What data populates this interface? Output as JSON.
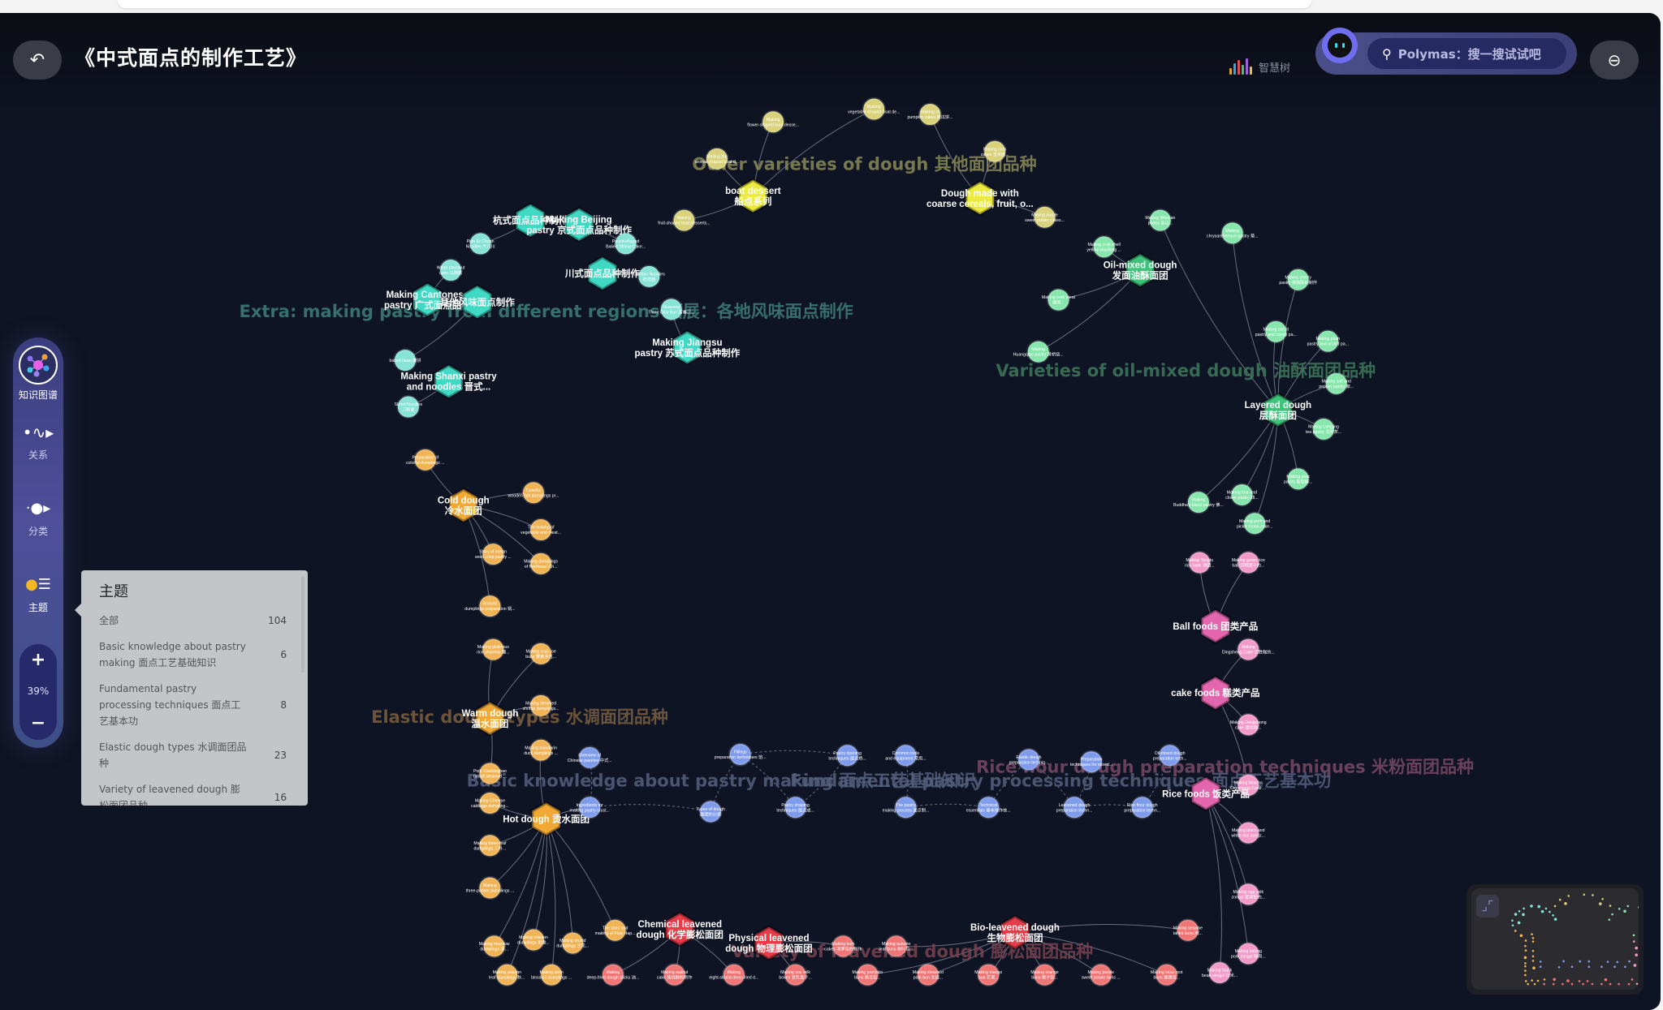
{
  "header": {
    "title": "《中式面点的制作工艺》",
    "logo_text": "智慧树",
    "search_placeholder": "Polymas：搜一搜试试吧",
    "back_icon": "back-arrow-icon",
    "right_icon": "exit-icon"
  },
  "sidebar": {
    "items": [
      {
        "label": "知识图谱",
        "icon": "knowledge-graph-icon",
        "active": true
      },
      {
        "label": "关系",
        "icon": "relation-icon"
      },
      {
        "label": "分类",
        "icon": "category-icon"
      },
      {
        "label": "主题",
        "icon": "topic-icon"
      }
    ],
    "zoom": {
      "plus": "+",
      "value": "39%",
      "minus": "−"
    }
  },
  "topic_panel": {
    "title": "主题",
    "items": [
      {
        "label": "全部",
        "count": "104"
      },
      {
        "label": "Basic knowledge about pastry making 面点工艺基础知识",
        "count": "6"
      },
      {
        "label": "Fundamental pastry processing techniques 面点工艺基本功",
        "count": "8"
      },
      {
        "label": "Elastic dough types 水调面团品种",
        "count": "23"
      },
      {
        "label": "Variety of leavened dough 膨松面团品种",
        "count": "16"
      }
    ]
  },
  "colors": {
    "yellow": {
      "leaf": "#d9d27a",
      "hub": "#ecea3c",
      "label": "#8a8a55"
    },
    "teal": {
      "leaf": "#86e3d6",
      "hub": "#3fd9c4",
      "label": "#3f7f7a"
    },
    "green": {
      "leaf": "#86e6ac",
      "hub": "#3cc47a",
      "label": "#3f7a5c"
    },
    "orange": {
      "leaf": "#f0b457",
      "hub": "#f2a934",
      "label": "#7a6040"
    },
    "blue": {
      "leaf": "#7f9cec",
      "hub": "#6f8ce8",
      "label": "#55607f"
    },
    "pink": {
      "leaf": "#f29bc8",
      "hub": "#e466ae",
      "label": "#7a4a66"
    },
    "red": {
      "leaf": "#f07575",
      "hub": "#e83c48",
      "label": "#7a4450"
    }
  },
  "clusters": [
    {
      "id": "c1",
      "group": "yellow",
      "label": "Other varieties of dough 其他面团品种"
    },
    {
      "id": "c2",
      "group": "teal",
      "label": "Extra: making pastry from different regions 拓展：各地风味面点制作"
    },
    {
      "id": "c3",
      "group": "green",
      "label": "Varieties of oil-mixed dough 油酥面团品种"
    },
    {
      "id": "c4",
      "group": "orange",
      "label": "Elastic dough types 水调面团品种"
    },
    {
      "id": "c5",
      "group": "blue",
      "label": "Basic knowledge about pastry making 面点工艺基础知识"
    },
    {
      "id": "c6",
      "group": "blue",
      "label": "Fundamental pastry processing techniques 面点工艺基本功"
    },
    {
      "id": "c7",
      "group": "pink",
      "label": "Rice flour dough preparation techniques 米粉面团品种"
    },
    {
      "id": "c8",
      "group": "red",
      "label": "Variety of leavened dough 膨松面团品种"
    }
  ],
  "nodes": [
    {
      "id": "y1",
      "group": "yellow",
      "hub": true,
      "lines": [
        "boat dessert",
        "船点系列"
      ]
    },
    {
      "id": "y2",
      "group": "yellow",
      "parent": "y1",
      "lines": [
        "Making",
        "flower-shaped boat desse..."
      ]
    },
    {
      "id": "y3",
      "group": "yellow",
      "parent": "y1",
      "lines": [
        "Making the",
        "animal-shaped boat d..."
      ]
    },
    {
      "id": "y4",
      "group": "yellow",
      "parent": "y1",
      "lines": [
        "Making",
        "fruit-shaped boat desserts..."
      ]
    },
    {
      "id": "y5",
      "group": "yellow",
      "parent": "y1",
      "lines": [
        "Making",
        "vegetable-shaped boat de..."
      ]
    },
    {
      "id": "y6",
      "group": "yellow",
      "hub": true,
      "lines": [
        "Dough made with",
        "coarse cereals, fruit, o..."
      ]
    },
    {
      "id": "y7",
      "group": "yellow",
      "parent": "y6",
      "lines": [
        "Making of",
        "pumpkin cakes 南瓜饼..."
      ]
    },
    {
      "id": "y8",
      "group": "yellow",
      "parent": "y6",
      "lines": [
        "Making corn",
        "cakes 玉米面..."
      ]
    },
    {
      "id": "y9",
      "group": "yellow",
      "parent": "y6",
      "lines": [
        "Making purple",
        "sweet potato cakes..."
      ]
    },
    {
      "id": "t1",
      "group": "teal",
      "hub": true,
      "lines": [
        "杭式面点品种制作"
      ]
    },
    {
      "id": "t2",
      "group": "teal",
      "hub": true,
      "lines": [
        "Making Beijing",
        "pastry 京式面点品种制作"
      ]
    },
    {
      "id": "t3",
      "group": "teal",
      "parent": "t1",
      "lines": [
        "Pian Er Chuan",
        "Noodles 片儿川"
      ]
    },
    {
      "id": "t4",
      "group": "teal",
      "parent": "t2",
      "lines": [
        "Pouch-shaped",
        "Baked Wheat Cake..."
      ]
    },
    {
      "id": "t5",
      "group": "teal",
      "hub": true,
      "lines": [
        "川式面点品种制作"
      ]
    },
    {
      "id": "t6",
      "group": "teal",
      "parent": "t5",
      "lines": [
        "Dandan Noodles",
        "担担面"
      ]
    },
    {
      "id": "t7",
      "group": "teal",
      "parent": "t8",
      "lines": [
        "Water chestnut",
        "cake 马蹄糕"
      ]
    },
    {
      "id": "t8",
      "group": "teal",
      "hub": true,
      "lines": [
        "Making Cantonese",
        "pastry 广式面点品种"
      ]
    },
    {
      "id": "t9",
      "group": "teal",
      "hub": true,
      "lines": [
        "其他风味面点制作"
      ]
    },
    {
      "id": "t10",
      "group": "teal",
      "parent": "t11",
      "lines": [
        "Huasong",
        "Three Dice Bun 富春三..."
      ]
    },
    {
      "id": "t11",
      "group": "teal",
      "hub": true,
      "lines": [
        "Making Jiangsu",
        "pastry 苏式面点品种制作"
      ]
    },
    {
      "id": "t12",
      "group": "teal",
      "parent": "t9",
      "lines": [
        "baked naan 馕饼"
      ]
    },
    {
      "id": "t13",
      "group": "teal",
      "hub": true,
      "lines": [
        "Making Shanxi pastry",
        "and noodles 晋式..."
      ]
    },
    {
      "id": "t14",
      "group": "teal",
      "parent": "t13",
      "lines": [
        "Sliced Noodles",
        "刀削面"
      ]
    },
    {
      "id": "g1",
      "group": "green",
      "hub": true,
      "lines": [
        "Oil-mixed dough",
        "发面油酥面团"
      ]
    },
    {
      "id": "g2",
      "group": "green",
      "parent": "g1",
      "lines": [
        "Making crab shell",
        "yellow shaobing ..."
      ]
    },
    {
      "id": "g3",
      "group": "green",
      "parent": "g1",
      "lines": [
        "Making pork meat",
        "猪肉..."
      ]
    },
    {
      "id": "g4",
      "group": "green",
      "parent": "g1",
      "lines": [
        "Making",
        "Huangqiao pastry 黄桥烧..."
      ]
    },
    {
      "id": "g5",
      "group": "green",
      "hub": true,
      "lines": [
        "Layered dough",
        "层酥面团"
      ]
    },
    {
      "id": "g6",
      "group": "green",
      "parent": "g5",
      "lines": [
        "Making Wushan",
        "pastry 巫山..."
      ]
    },
    {
      "id": "g7",
      "group": "green",
      "parent": "g5",
      "lines": [
        "Making",
        "chrysanthemum pastry 菊..."
      ]
    },
    {
      "id": "g8",
      "group": "green",
      "parent": "g5",
      "lines": [
        "Making cherry",
        "pastry 樱桃酥的制作"
      ]
    },
    {
      "id": "g9",
      "group": "green",
      "parent": "g5",
      "lines": [
        "Making carrot",
        "pastry and candy pa..."
      ]
    },
    {
      "id": "g10",
      "group": "green",
      "parent": "g5",
      "lines": [
        "Making plum",
        "pastry and orchid pa..."
      ]
    },
    {
      "id": "g11",
      "group": "green",
      "parent": "g5",
      "lines": [
        "Making salt and",
        "pepper pastry 椒..."
      ]
    },
    {
      "id": "g12",
      "group": "green",
      "parent": "g5",
      "lines": [
        "Making Longjing",
        "tea pastry 龙井茶..."
      ]
    },
    {
      "id": "g13",
      "group": "green",
      "parent": "g5",
      "lines": [
        "Making pear",
        "pastry 梨型酥..."
      ]
    },
    {
      "id": "g14",
      "group": "green",
      "parent": "g5",
      "lines": [
        "Making four-leaf",
        "clover pastry 四..."
      ]
    },
    {
      "id": "g15",
      "group": "green",
      "parent": "g5",
      "lines": [
        "Making",
        "Buddha's Hand pastry 佛..."
      ]
    },
    {
      "id": "g16",
      "group": "green",
      "parent": "g5",
      "lines": [
        "Making pork and",
        "pickle moon cake..."
      ]
    },
    {
      "id": "o1",
      "group": "orange",
      "hub": true,
      "lines": [
        "Cold dough",
        "冷水面团"
      ]
    },
    {
      "id": "o2",
      "group": "orange",
      "parent": "o1",
      "lines": [
        "Preparation of",
        "colorful dumplings ..."
      ]
    },
    {
      "id": "o3",
      "group": "orange",
      "parent": "o1",
      "lines": [
        "Colorful",
        "wooden fish dumplings pr..."
      ]
    },
    {
      "id": "o4",
      "group": "orange",
      "parent": "o1",
      "lines": [
        "The making of",
        "vegetable and meat..."
      ]
    },
    {
      "id": "o5",
      "group": "orange",
      "parent": "o1",
      "lines": [
        "Story of melon",
        "seed crisp pastry ..."
      ]
    },
    {
      "id": "o6",
      "group": "orange",
      "parent": "o1",
      "lines": [
        "Making dumplings",
        "of Northeast Ch..."
      ]
    },
    {
      "id": "o7",
      "group": "orange",
      "parent": "o1",
      "lines": [
        "Braised",
        "dumplings preparation 锅..."
      ]
    },
    {
      "id": "o8",
      "group": "orange",
      "hub": true,
      "lines": [
        "Warm dough",
        "温水面团"
      ]
    },
    {
      "id": "o9",
      "group": "orange",
      "parent": "o8",
      "lines": [
        "Making glutinous",
        "rice shaomai 糯..."
      ]
    },
    {
      "id": "o10",
      "group": "orange",
      "parent": "o8",
      "lines": [
        "Making crab roe",
        "buns 蟹黄汤包..."
      ]
    },
    {
      "id": "o11",
      "group": "orange",
      "parent": "o8",
      "lines": [
        "Making steamed",
        "shrimp dumplings..."
      ]
    },
    {
      "id": "o12",
      "group": "orange",
      "parent": "o15",
      "lines": [
        "Making mandarin",
        "duck dumplings ..."
      ]
    },
    {
      "id": "o13",
      "group": "orange",
      "parent": "o8",
      "lines": [
        "Pork Xiaolongbao",
        "(small steamed ..."
      ]
    },
    {
      "id": "o14",
      "group": "orange",
      "parent": "o15",
      "lines": [
        "Making Chinese",
        "cabbage dumpling..."
      ]
    },
    {
      "id": "o15",
      "group": "orange",
      "hub": true,
      "lines": [
        "Hot dough 烫水面团"
      ]
    },
    {
      "id": "o16",
      "group": "orange",
      "parent": "o15",
      "lines": [
        "Making three-leaf",
        "dumplings 三叶..."
      ]
    },
    {
      "id": "o17",
      "group": "orange",
      "parent": "o15",
      "lines": [
        "Making",
        "three-pocket dumplings ..."
      ]
    },
    {
      "id": "o18",
      "group": "orange",
      "parent": "o15",
      "lines": [
        "Making meadow",
        "dumplings 草..."
      ]
    },
    {
      "id": "o19",
      "group": "orange",
      "parent": "o15",
      "lines": [
        "Making mission",
        "dumplings 鸳鸯..."
      ]
    },
    {
      "id": "o20",
      "group": "orange",
      "parent": "o15",
      "lines": [
        "Making orchid",
        "dumplings 兰花..."
      ]
    },
    {
      "id": "o21",
      "group": "orange",
      "parent": "o15",
      "lines": [
        "The story and",
        "making of Four Hap..."
      ]
    },
    {
      "id": "o22",
      "group": "orange",
      "parent": "o15",
      "lines": [
        "Making autumn",
        "leaf dumplings 秋..."
      ]
    },
    {
      "id": "o23",
      "group": "orange",
      "parent": "o15",
      "lines": [
        "Making plum",
        "blossom dumplings ..."
      ]
    },
    {
      "id": "b1",
      "group": "blue",
      "lines": [
        "Overview of",
        "Chinese pastries 中式..."
      ]
    },
    {
      "id": "b2",
      "group": "blue",
      "lines": [
        "Ingredients for",
        "making pastry crust..."
      ]
    },
    {
      "id": "b3",
      "group": "blue",
      "lines": [
        "Types of dough",
        "面团的分类"
      ]
    },
    {
      "id": "b4",
      "group": "blue",
      "lines": [
        "Fillings",
        "preparation techniques 馅..."
      ]
    },
    {
      "id": "b5",
      "group": "blue",
      "lines": [
        "Pastry shaping",
        "techniques 面点成..."
      ]
    },
    {
      "id": "b6",
      "group": "blue",
      "lines": [
        "Pastry ripening",
        "techniques 面点熟..."
      ]
    },
    {
      "id": "b7",
      "group": "blue",
      "lines": [
        "Common tools",
        "and equipment 常用..."
      ]
    },
    {
      "id": "b8",
      "group": "blue",
      "lines": [
        "The pastry",
        "making process 面点制..."
      ]
    },
    {
      "id": "b9",
      "group": "blue",
      "lines": [
        "Technical",
        "essentials 基本操作技..."
      ]
    },
    {
      "id": "b10",
      "group": "blue",
      "lines": [
        "Elastic dough",
        "preparation techniq..."
      ]
    },
    {
      "id": "b11",
      "group": "blue",
      "lines": [
        "Preparation",
        "techniques for mixed..."
      ]
    },
    {
      "id": "b12",
      "group": "blue",
      "lines": [
        "Leavened dough",
        "preparation techn..."
      ]
    },
    {
      "id": "b13",
      "group": "blue",
      "lines": [
        "Oil-mixed dough",
        "preparation tech..."
      ]
    },
    {
      "id": "b14",
      "group": "blue",
      "lines": [
        "Rice flour dough",
        "preparation techn..."
      ]
    },
    {
      "id": "p1",
      "group": "pink",
      "parent": "p3",
      "lines": [
        "Making Tangtu",
        "rice balls 汤团..."
      ]
    },
    {
      "id": "p2",
      "group": "pink",
      "parent": "p3",
      "lines": [
        "Making green rice",
        "ball 清明团子的..."
      ]
    },
    {
      "id": "p3",
      "group": "pink",
      "hub": true,
      "lines": [
        "Ball foods 团类产品"
      ]
    },
    {
      "id": "p4",
      "group": "pink",
      "parent": "p5",
      "lines": [
        "Making",
        "Dingsheng Cake 定胜糕的..."
      ]
    },
    {
      "id": "p5",
      "group": "pink",
      "hub": true,
      "lines": [
        "cake foods 糕类产品"
      ]
    },
    {
      "id": "p6",
      "group": "pink",
      "parent": "p5",
      "lines": [
        "Making Dangshong",
        "cake 蛋烘糕..."
      ]
    },
    {
      "id": "p7",
      "group": "pink",
      "parent": "p5",
      "lines": [
        "Making Matcha",
        "Dingsheng Cake ..."
      ]
    },
    {
      "id": "p8",
      "group": "pink",
      "hub": true,
      "lines": [
        "Rice foods 饭类产品"
      ]
    },
    {
      "id": "p9",
      "group": "pink",
      "parent": "p8",
      "lines": [
        "Making black and",
        "white rice zongz..."
      ]
    },
    {
      "id": "p10",
      "group": "pink",
      "parent": "p8",
      "lines": [
        "Making egg yolk",
        "zongzi 蛋黄粽的..."
      ]
    },
    {
      "id": "p11",
      "group": "pink",
      "parent": "p8",
      "lines": [
        "Making baking",
        "pork zongzi 鲜肉..."
      ]
    },
    {
      "id": "p12",
      "group": "pink",
      "parent": "p8",
      "lines": [
        "Making black",
        "bean zongzi 乌米..."
      ]
    },
    {
      "id": "r1",
      "group": "red",
      "hub": true,
      "lines": [
        "Chemical leavened",
        "dough 化学膨松面团"
      ]
    },
    {
      "id": "r2",
      "group": "red",
      "hub": true,
      "lines": [
        "Physical leavened",
        "dough 物理膨松面团"
      ]
    },
    {
      "id": "r3",
      "group": "red",
      "hub": true,
      "lines": [
        "Bio-leavened dough",
        "生物膨松面团"
      ]
    },
    {
      "id": "r4",
      "group": "red",
      "parent": "r1",
      "lines": [
        "Making",
        "deep-fried dough sticks 油..."
      ]
    },
    {
      "id": "r5",
      "group": "red",
      "parent": "r1",
      "lines": [
        "Making walnut",
        "cake 核桃酥的制作"
      ]
    },
    {
      "id": "r6",
      "group": "red",
      "parent": "r1",
      "lines": [
        "Making",
        "eight-strand deep-fried d..."
      ]
    },
    {
      "id": "r7",
      "group": "red",
      "parent": "r2",
      "lines": [
        "Making soy milk",
        "boxes 豆乳盒子..."
      ]
    },
    {
      "id": "r8",
      "group": "red",
      "parent": "r2",
      "lines": [
        "Making bolo",
        "cakes 菠萝包的制作"
      ]
    },
    {
      "id": "r9",
      "group": "red",
      "parent": "r3",
      "lines": [
        "Making autumn",
        "leaf buns 秋叶包..."
      ]
    },
    {
      "id": "r10",
      "group": "red",
      "parent": "r3",
      "lines": [
        "Making pumpkin",
        "buns 南瓜包..."
      ]
    },
    {
      "id": "r11",
      "group": "red",
      "parent": "r3",
      "lines": [
        "Making steamed",
        "pork bun 叉烧..."
      ]
    },
    {
      "id": "r12",
      "group": "red",
      "parent": "r3",
      "lines": [
        "Making mango",
        "bun 芒果..."
      ]
    },
    {
      "id": "r13",
      "group": "red",
      "parent": "r3",
      "lines": [
        "Making orange",
        "buns 橙子包..."
      ]
    },
    {
      "id": "r14",
      "group": "red",
      "parent": "r3",
      "lines": [
        "Making purple",
        "sweet potato buns ..."
      ]
    },
    {
      "id": "r15",
      "group": "red",
      "parent": "r3",
      "lines": [
        "Making lotus root",
        "buns 莲藕包..."
      ]
    },
    {
      "id": "r16",
      "group": "red",
      "parent": "r3",
      "lines": [
        "Making sesame",
        "tahini buns 麻..."
      ]
    }
  ],
  "links": [
    [
      "b1",
      "b2"
    ],
    [
      "b2",
      "b3"
    ],
    [
      "b3",
      "b4"
    ],
    [
      "b4",
      "b5"
    ],
    [
      "b4",
      "b6"
    ],
    [
      "b6",
      "b5"
    ],
    [
      "b7",
      "b8"
    ],
    [
      "b8",
      "b9"
    ],
    [
      "b9",
      "b10"
    ],
    [
      "b10",
      "b12"
    ],
    [
      "b11",
      "b12"
    ],
    [
      "b12",
      "b14"
    ],
    [
      "b13",
      "b14"
    ],
    [
      "o15",
      "b2"
    ],
    [
      "t1",
      "t2"
    ],
    [
      "t8",
      "t9"
    ]
  ]
}
